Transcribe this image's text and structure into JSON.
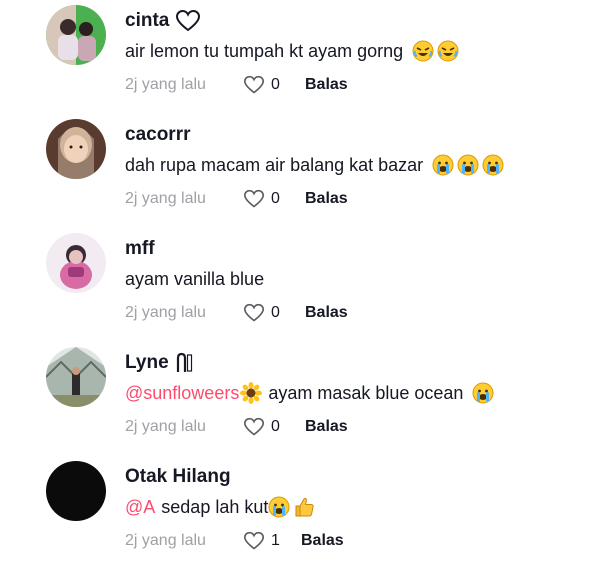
{
  "comments": [
    {
      "username": "cinta",
      "suffix_icon": "heart-outline-icon",
      "text": "air lemon tu tumpah kt ayam gorng",
      "mention": "",
      "emojis": [
        "rolling-laughing-emoji",
        "rolling-laughing-emoji"
      ],
      "time": "2j yang lalu",
      "likes": "0",
      "reply_label": "Balas"
    },
    {
      "username": "cacorrr",
      "suffix_icon": "",
      "text": "dah rupa macam air balang kat bazar",
      "mention": "",
      "emojis": [
        "crying-emoji",
        "crying-emoji",
        "crying-emoji"
      ],
      "time": "2j yang lalu",
      "likes": "0",
      "reply_label": "Balas"
    },
    {
      "username": "mff",
      "suffix_icon": "",
      "text": "ayam vanilla blue",
      "mention": "",
      "emojis": [],
      "time": "2j yang lalu",
      "likes": "0",
      "reply_label": "Balas"
    },
    {
      "username": "Lyne",
      "suffix_icon": "symbol-glyph-icon",
      "text": "ayam masak blue ocean",
      "mention": "@sunflowеers",
      "mention_emoji": "sunflower-emoji",
      "emojis": [
        "crying-emoji"
      ],
      "time": "2j yang lalu",
      "likes": "0",
      "reply_label": "Balas"
    },
    {
      "username": "Otak Hilang",
      "suffix_icon": "",
      "text": "sedap lah kut",
      "mention": "@A",
      "emojis": [
        "crying-emoji",
        "thumbs-up-emoji"
      ],
      "time": "2j yang lalu",
      "likes": "1",
      "reply_label": "Balas"
    }
  ],
  "colors": {
    "text": "#161823",
    "muted": "#a0a0a6",
    "mention": "#fe2c55",
    "emoji_face": "#ffcc33"
  }
}
